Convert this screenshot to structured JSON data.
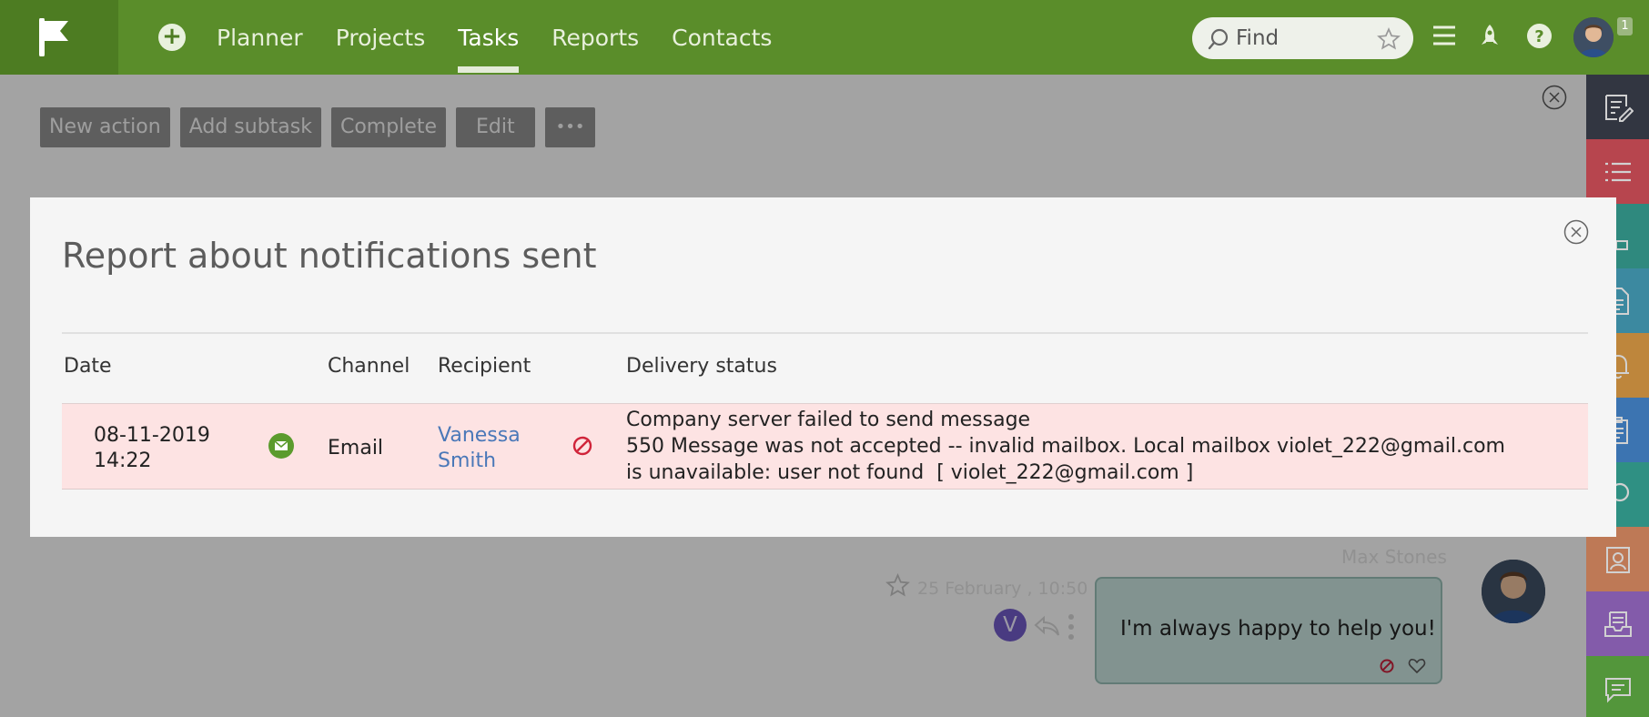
{
  "nav": {
    "items": [
      {
        "label": "Planner",
        "active": false
      },
      {
        "label": "Projects",
        "active": false
      },
      {
        "label": "Tasks",
        "active": true
      },
      {
        "label": "Reports",
        "active": false
      },
      {
        "label": "Contacts",
        "active": false
      }
    ],
    "search_placeholder": "Find",
    "notification_badge": "1"
  },
  "toolbar": {
    "buttons": [
      "New action",
      "Add subtask",
      "Complete",
      "Edit",
      "•••"
    ]
  },
  "rail_colors": [
    "#3d4250",
    "#e05560",
    "#3aa89a",
    "#4aa8c4",
    "#e8a44a",
    "#4a8ed8",
    "#3ab0a0",
    "#e8946a",
    "#a070d0",
    "#66b848"
  ],
  "modal": {
    "title": "Report about notifications sent",
    "columns": [
      "Date",
      "Channel",
      "Recipient",
      "Delivery status"
    ],
    "rows": [
      {
        "date_line1": "08-11-2019",
        "date_line2": "14:22",
        "channel_icon": "mail-icon",
        "channel": "Email",
        "recipient_line1": "Vanessa",
        "recipient_line2": "Smith",
        "status_icon": "ban-icon",
        "status_line1": "Company server failed to send message",
        "status_line2": "550 Message was not accepted -- invalid mailbox. Local mailbox violet_222@gmail.com",
        "status_line3": "is unavailable: user not found  [ violet_222@gmail.com ]"
      }
    ]
  },
  "chat": {
    "author": "Max Stones",
    "date": "25 February , 10:50",
    "message": "I'm always happy to help you!",
    "sender_initial": "V"
  },
  "colors": {
    "topbar": "#5a8d2a",
    "error_row": "#fde3e3",
    "link": "#4a78b8",
    "error_icon": "#d0243a"
  }
}
